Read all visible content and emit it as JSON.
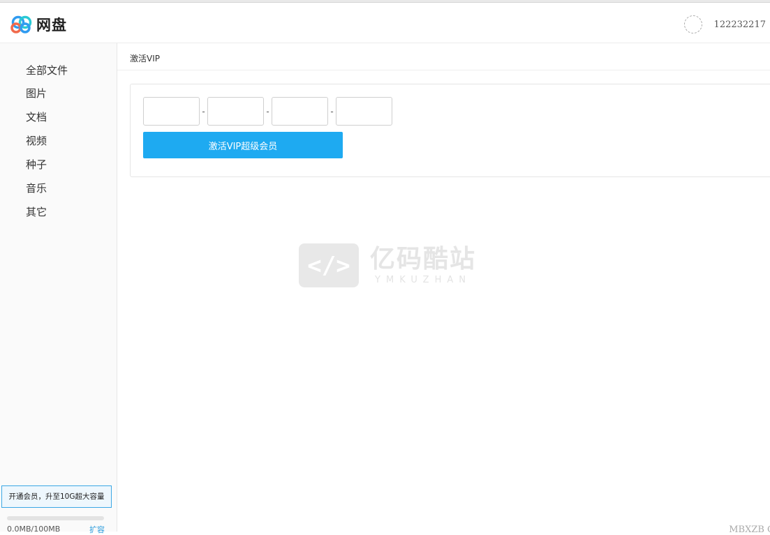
{
  "header": {
    "logo_text": "网盘",
    "username": "122232217"
  },
  "sidebar": {
    "items": [
      {
        "label": "全部文件"
      },
      {
        "label": "图片"
      },
      {
        "label": "文档"
      },
      {
        "label": "视频"
      },
      {
        "label": "种子"
      },
      {
        "label": "音乐"
      },
      {
        "label": "其它"
      }
    ],
    "vip_banner": "开通会员，升至10G超大容量",
    "storage": {
      "used_text": "0.0MB/100MB",
      "used_fraction": 0.0,
      "expand_label": "扩容"
    }
  },
  "main": {
    "breadcrumb": "激活VIP",
    "code_fields": [
      {
        "value": ""
      },
      {
        "value": ""
      },
      {
        "value": ""
      },
      {
        "value": ""
      }
    ],
    "separator": "-",
    "activate_label": "激活VIP超级会员"
  },
  "watermark": {
    "icon_glyph": "</>",
    "cn": "亿码酷站",
    "en": "YMKUZHAN"
  },
  "footer": {
    "partial_text": "MBXZB C"
  },
  "colors": {
    "accent": "#1eaaf2",
    "sidebar_bg": "#fafafa",
    "banner_border": "#3aa7e5"
  },
  "icons": {
    "logo": "cloud-rings-logo-icon",
    "avatar": "avatar-placeholder-icon"
  }
}
